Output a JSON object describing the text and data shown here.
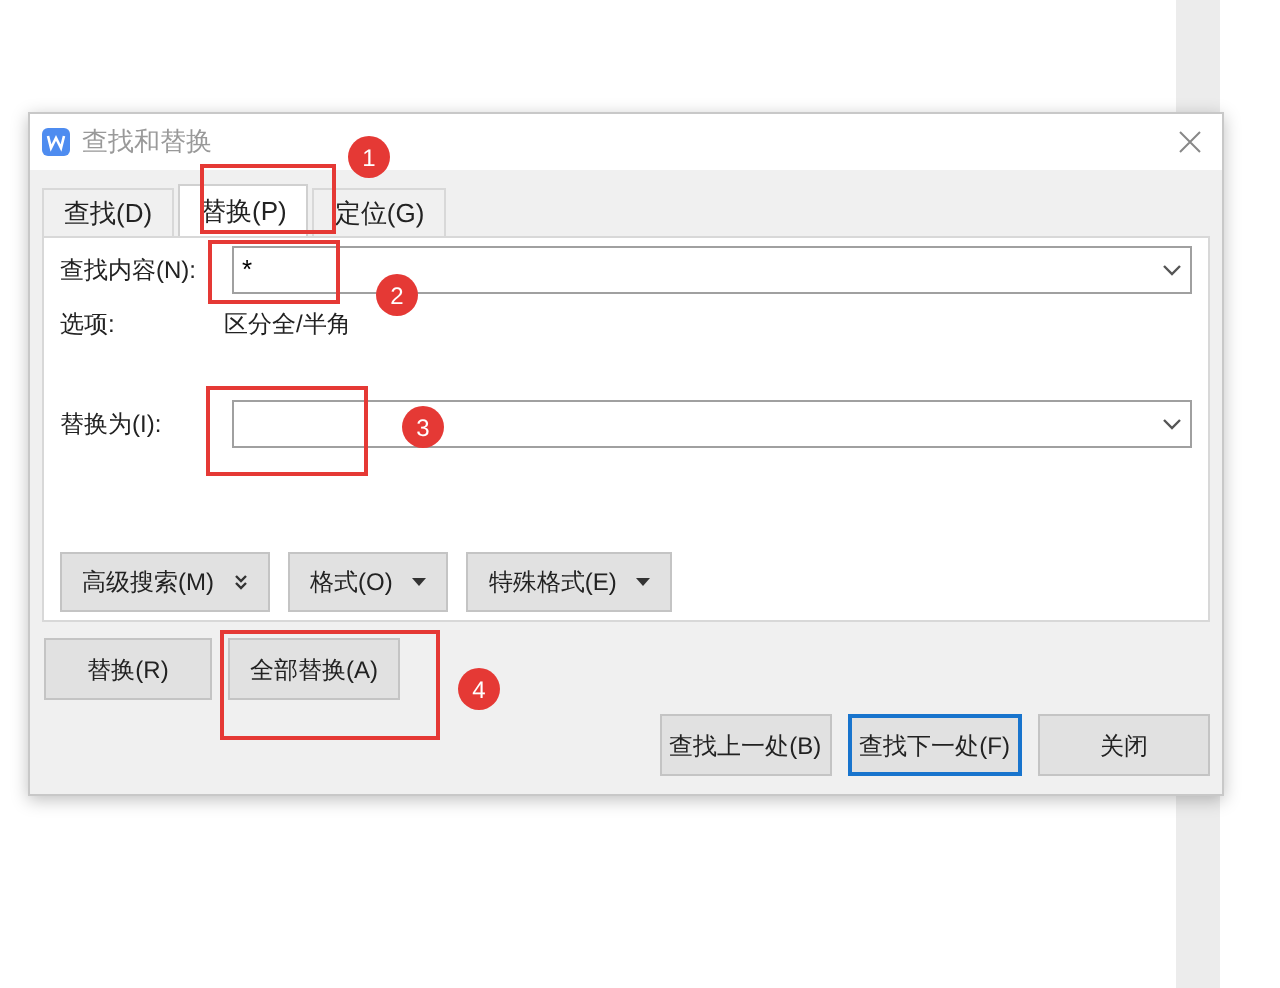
{
  "dialog": {
    "title": "查找和替换",
    "tabs": [
      {
        "label": "查找(D)",
        "selected": false
      },
      {
        "label": "替换(P)",
        "selected": true
      },
      {
        "label": "定位(G)",
        "selected": false
      }
    ],
    "find": {
      "label": "查找内容(N):",
      "value": "*"
    },
    "options": {
      "label": "选项:",
      "value": "区分全/半角"
    },
    "replace": {
      "label": "替换为(I):"
    },
    "format_buttons": [
      {
        "label": "高级搜索(M)",
        "kind": "more"
      },
      {
        "label": "格式(O)",
        "kind": "menu"
      },
      {
        "label": "特殊格式(E)",
        "kind": "menu"
      }
    ],
    "replace_buttons": [
      "替换(R)",
      "全部替换(A)"
    ],
    "nav_buttons": [
      {
        "label": "查找上一处(B)",
        "selected": false
      },
      {
        "label": "查找下一处(F)",
        "selected": true
      },
      {
        "label": "关闭",
        "selected": false
      }
    ]
  },
  "annotations": [
    "1",
    "2",
    "3",
    "4"
  ]
}
